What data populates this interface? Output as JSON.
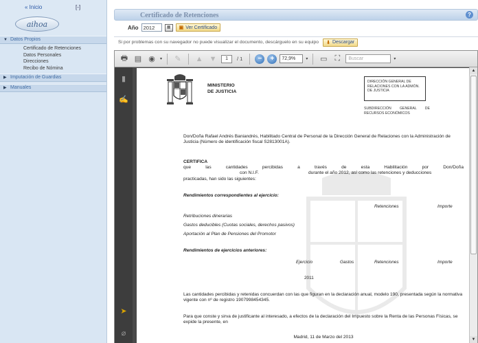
{
  "sidebar": {
    "home_link": "« Inicio",
    "collapse_link": "[-]",
    "logo_text": "aihoa",
    "sections": [
      {
        "label": "Datos Propios",
        "expanded": true,
        "items": [
          "Certificado de Retenciones",
          "Datos Personales",
          "Direcciones",
          "Recibo de Nómina"
        ]
      },
      {
        "label": "Imputación de Guardias",
        "expanded": false,
        "items": []
      },
      {
        "label": "Manuales",
        "expanded": false,
        "items": []
      }
    ]
  },
  "header": {
    "title": "Certificado de Retenciones",
    "help_icon": "?"
  },
  "form": {
    "year_label": "Año",
    "year_value": "2012",
    "view_button": "Ver Certificado",
    "note": "Si por problemas con su navegador no puede visualizar el documento, descárguelo en su equipo",
    "download_button": "Descargar"
  },
  "viewer": {
    "page_current": "1",
    "page_total": "/ 1",
    "zoom": "72,9%",
    "search_placeholder": "Buscar"
  },
  "document": {
    "ministry_line1": "MINISTERIO",
    "ministry_line2": "DE JUSTICIA",
    "dg_box": [
      "DIRECCIÓN GENERAL DE",
      "RELACIONES CON LA ADMÓN.",
      "DE JUSTICIA"
    ],
    "subdir": [
      "SUBDIRECCIÓN GENERAL DE",
      "RECURSOS ECONÓMICOS"
    ],
    "intro": "Don/Doña Rafael Andrés Baniandrés, Habilitado Central de Personal de la Dirección General de Relaciones con la Administración de Justicia (Número de identificación fiscal S2813001A).",
    "certifica": "CERTIFICA",
    "cert_line1": "que las cantidades percibidas a través de esta Habilitación por Don/Doña",
    "cert_line2": "con N.I.F.",
    "cert_line2b": "durante el año 2012, así como las retenciones y deducciones",
    "cert_line3": "practicadas, han sido las siguientes:",
    "sec1_title": "Rendimientos correspondientes al ejercicio:",
    "col_retenciones": "Retenciones",
    "col_importe": "Importe",
    "row1": "Retribuciones dinerarias",
    "row2": "Gastos deducibles (Cuotas sociales, derechos pasivos)",
    "row3": "Aportación al Plan de Pensiones del Promotor",
    "sec2_title": "Rendimientos de ejercicios anteriores:",
    "col_ejercicio": "Ejercicio",
    "col_gastos": "Gastos",
    "col_retenciones2": "Retenciones",
    "col_importe2": "Importe",
    "year_row": "2011",
    "closing1": "Las cantidades percibidas y retenidas concuerdan con las que figuran en la declaración anual, modelo 190, presentada según la normativa vigente con nº de registro 1907998454345.",
    "closing2": "Para que conste y sirva de justificante al interesado, a efectos de la declaración del Impuesto sobre la Renta de las Personas Físicas, se expide la presente, en",
    "date": "Madrid, 11 de Marzo del 2013"
  }
}
